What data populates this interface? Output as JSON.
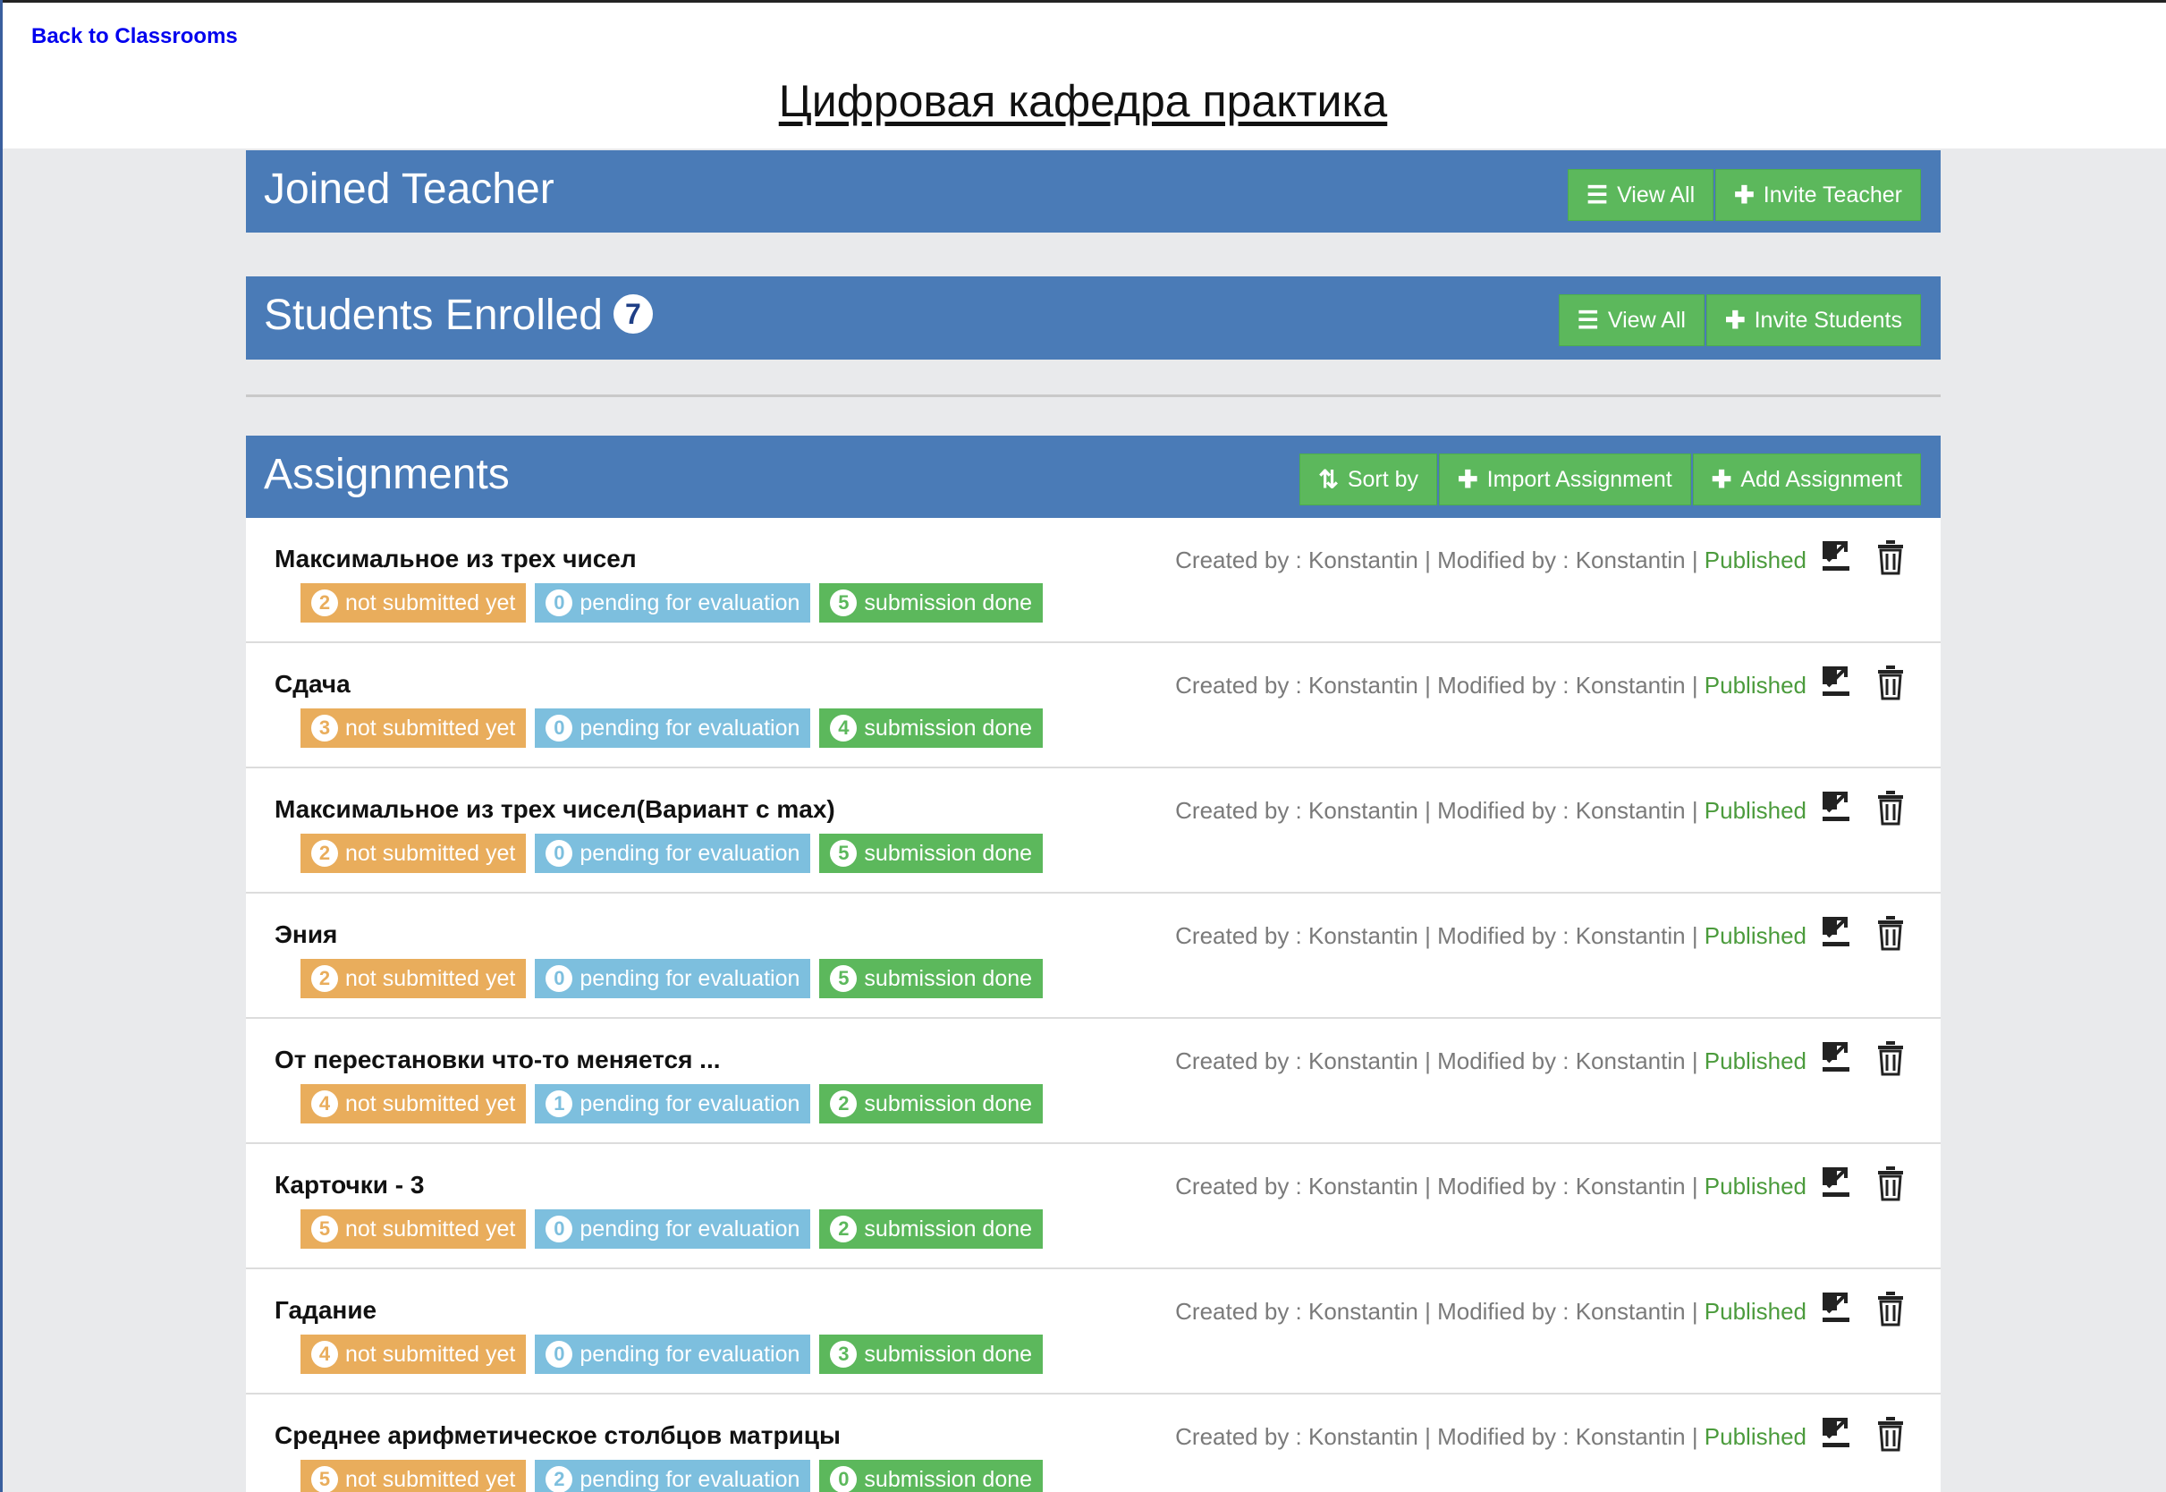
{
  "nav": {
    "back_label": "Back to Classrooms"
  },
  "classroom": {
    "title": "Цифровая кафедра практика"
  },
  "teachers": {
    "title": "Joined Teacher",
    "view_all_label": "View All",
    "invite_label": "Invite Teacher"
  },
  "students": {
    "title": "Students Enrolled",
    "count": "7",
    "view_all_label": "View All",
    "invite_label": "Invite Students"
  },
  "assignments": {
    "title": "Assignments",
    "sort_label": "Sort by",
    "import_label": "Import Assignment",
    "add_label": "Add Assignment",
    "status_labels": {
      "not_submitted": "not submitted yet",
      "pending": "pending for evaluation",
      "done": "submission done"
    },
    "items": [
      {
        "title": "Максимальное из трех чисел",
        "not_submitted": "2",
        "pending": "0",
        "done": "5",
        "created_by": "Created by : Konstantin",
        "modified_by": "Modified by : Konstantin",
        "status": "Published"
      },
      {
        "title": "Сдача",
        "not_submitted": "3",
        "pending": "0",
        "done": "4",
        "created_by": "Created by : Konstantin",
        "modified_by": "Modified by : Konstantin",
        "status": "Published"
      },
      {
        "title": "Максимальное из трех чисел(Вариант с max)",
        "not_submitted": "2",
        "pending": "0",
        "done": "5",
        "created_by": "Created by : Konstantin",
        "modified_by": "Modified by : Konstantin",
        "status": "Published"
      },
      {
        "title": "Эния",
        "not_submitted": "2",
        "pending": "0",
        "done": "5",
        "created_by": "Created by : Konstantin",
        "modified_by": "Modified by : Konstantin",
        "status": "Published"
      },
      {
        "title": "От перестановки что-то меняется ...",
        "not_submitted": "4",
        "pending": "1",
        "done": "2",
        "created_by": "Created by : Konstantin",
        "modified_by": "Modified by : Konstantin",
        "status": "Published"
      },
      {
        "title": "Карточки - 3",
        "not_submitted": "5",
        "pending": "0",
        "done": "2",
        "created_by": "Created by : Konstantin",
        "modified_by": "Modified by : Konstantin",
        "status": "Published"
      },
      {
        "title": "Гадание",
        "not_submitted": "4",
        "pending": "0",
        "done": "3",
        "created_by": "Created by : Konstantin",
        "modified_by": "Modified by : Konstantin",
        "status": "Published"
      },
      {
        "title": "Среднее арифметическое столбцов матрицы",
        "not_submitted": "5",
        "pending": "2",
        "done": "0",
        "created_by": "Created by : Konstantin",
        "modified_by": "Modified by : Konstantin",
        "status": "Published"
      }
    ]
  },
  "colors": {
    "panel_header": "#4a7bb7",
    "button_green": "#5cb85c",
    "label_orange": "#e9ad5c",
    "label_blue": "#7dbfde",
    "label_green": "#5cb85c",
    "published_text": "#4b9b3c",
    "page_background": "#e9eaec"
  },
  "icons": {
    "list": "list-icon",
    "plus": "plus-icon",
    "sort": "sort-icon",
    "export": "export-icon",
    "trash": "trash-icon"
  }
}
